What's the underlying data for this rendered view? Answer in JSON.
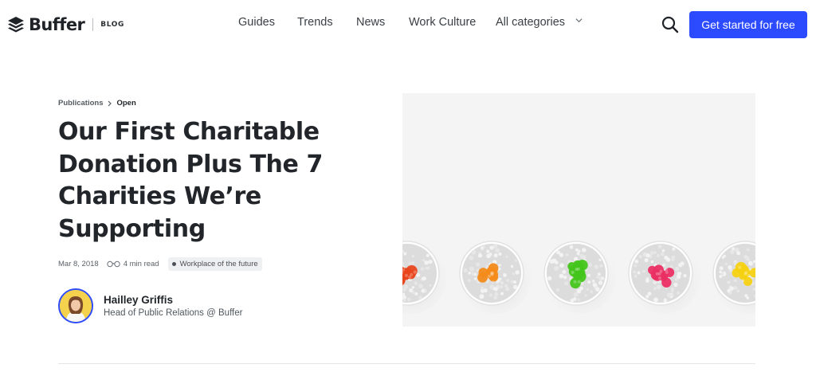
{
  "header": {
    "brand": "Buffer",
    "section": "BLOG",
    "nav": [
      {
        "label": "Guides"
      },
      {
        "label": "Trends"
      },
      {
        "label": "News"
      },
      {
        "label": "Work Culture"
      },
      {
        "label": "All categories"
      }
    ],
    "cta_label": "Get started for free",
    "icons": {
      "logo": "buffer-stack-logo-icon",
      "search": "search-icon",
      "chevron": "chevron-down-icon"
    },
    "cta_color": "#2c4bff"
  },
  "article": {
    "breadcrumb": {
      "parent": "Publications",
      "current": "Open"
    },
    "title": "Our First Charitable Donation Plus The 7 Charities We’re Supporting",
    "date": "Mar 8, 2018",
    "read_time": "4 min read",
    "tag": "Workplace of the future",
    "author": {
      "name": "Hailley Griffis",
      "role": "Head of Public Relations @ Buffer"
    }
  },
  "hero_image": {
    "description_icon": "flower-pots-image",
    "flower_colors": [
      "#e8461c",
      "#f38b1a",
      "#43c51b",
      "#ea2f63",
      "#f6d112"
    ]
  }
}
